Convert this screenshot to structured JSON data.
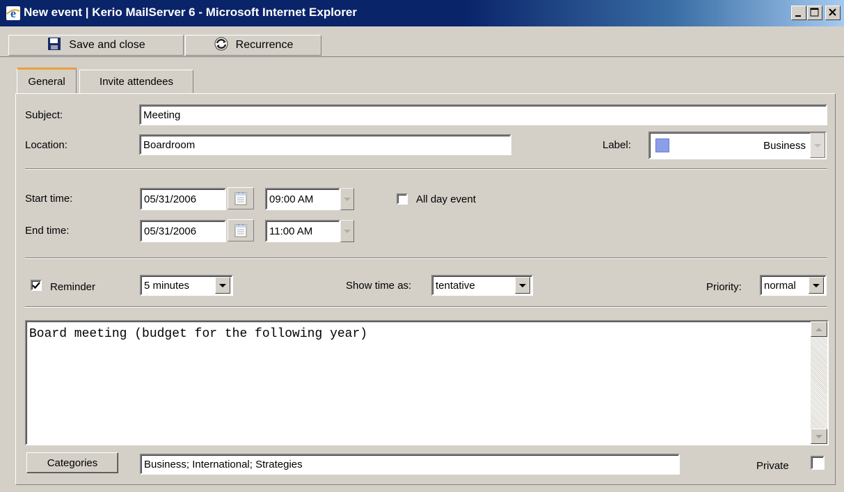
{
  "window": {
    "title": "New event | Kerio MailServer 6 - Microsoft Internet Explorer"
  },
  "toolbar": {
    "save_label": "Save and close",
    "recurrence_label": "Recurrence"
  },
  "tabs": [
    {
      "label": "General",
      "active": true
    },
    {
      "label": "Invite attendees",
      "active": false
    }
  ],
  "form": {
    "subject_label": "Subject:",
    "subject_value": "Meeting",
    "location_label": "Location:",
    "location_value": "Boardroom",
    "label_label": "Label:",
    "label_value": "Business",
    "label_color": "#8c9ee8",
    "start_label": "Start time:",
    "start_date": "05/31/2006",
    "start_time": "09:00 AM",
    "end_label": "End time:",
    "end_date": "05/31/2006",
    "end_time": "11:00 AM",
    "all_day_label": "All day event",
    "all_day_checked": false,
    "reminder_label": "Reminder",
    "reminder_checked": true,
    "reminder_value": "5 minutes",
    "show_time_label": "Show time as:",
    "show_time_value": "tentative",
    "priority_label": "Priority:",
    "priority_value": "normal",
    "notes": "Board meeting (budget for the following year)",
    "categories_label": "Categories",
    "categories_value": "Business; International; Strategies",
    "private_label": "Private",
    "private_checked": false
  },
  "colors": {
    "titlebar": "#0a246a",
    "face": "#d4d0c8",
    "active_tab_accent": "#e8a23a"
  },
  "icons": [
    "ie-icon",
    "minimize-icon",
    "maximize-icon",
    "close-icon",
    "floppy-disk-icon",
    "recurrence-icon",
    "calendar-icon",
    "dropdown-arrow-icon",
    "checkmark-icon",
    "scroll-up-icon",
    "scroll-down-icon"
  ]
}
